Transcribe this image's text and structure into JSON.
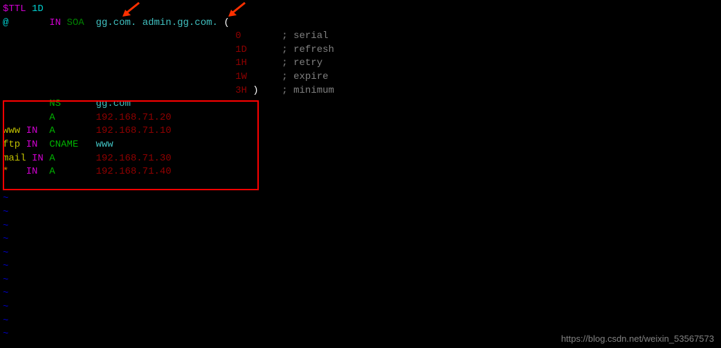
{
  "header": {
    "ttl_directive": "$TTL",
    "ttl_value": "1D",
    "origin": "@",
    "in": "IN",
    "soa": "SOA",
    "primary_ns": "gg.com.",
    "admin_email": "admin.gg.com.",
    "open_paren": "("
  },
  "soa_params": [
    {
      "value": "0",
      "comment": "; serial"
    },
    {
      "value": "1D",
      "comment": "; refresh"
    },
    {
      "value": "1H",
      "comment": "; retry"
    },
    {
      "value": "1W",
      "comment": "; expire"
    },
    {
      "value": "3H",
      "close": ")",
      "comment": "; minimum"
    }
  ],
  "records": [
    {
      "name": "",
      "in": "",
      "type": "NS",
      "value": "gg.com"
    },
    {
      "name": "",
      "in": "",
      "type": "A",
      "value": "192.168.71.20"
    },
    {
      "name": "www",
      "in": "IN",
      "type": "A",
      "value": "192.168.71.10"
    },
    {
      "name": "ftp",
      "in": "IN",
      "type": "CNAME",
      "value": "www"
    },
    {
      "name": "mail",
      "in": "IN",
      "type": "A",
      "value": "192.168.71.30"
    },
    {
      "name": "*",
      "in": "IN",
      "type": "A",
      "value": "192.168.71.40"
    }
  ],
  "tilde": "~",
  "watermark": "https://blog.csdn.net/weixin_53567573"
}
